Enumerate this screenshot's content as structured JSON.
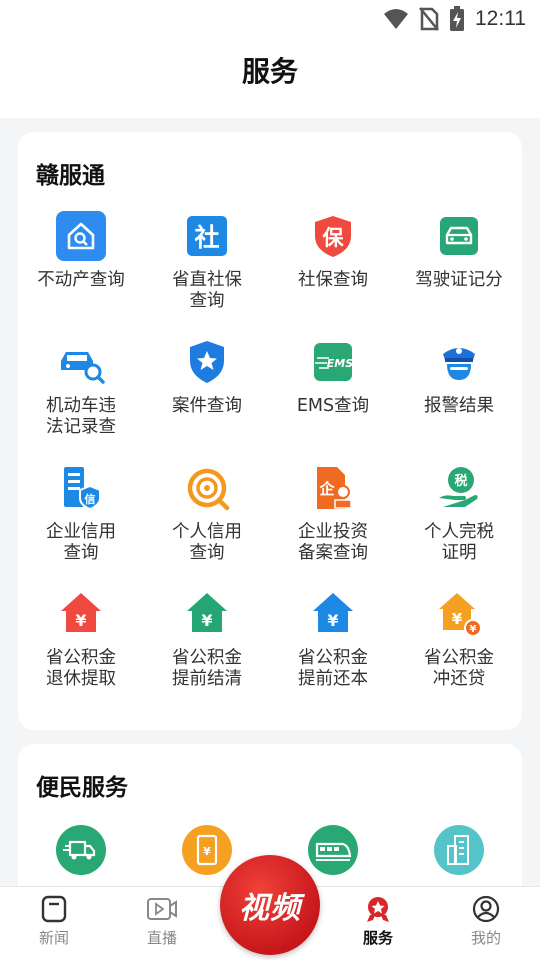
{
  "status": {
    "time": "12:11"
  },
  "header": {
    "title": "服务"
  },
  "section1": {
    "title": "赣服通",
    "items": [
      {
        "label": "不动产查询",
        "icon": "house-search-icon"
      },
      {
        "label": "省直社保\n查询",
        "icon": "social-security-icon"
      },
      {
        "label": "社保查询",
        "icon": "shield-bao-icon"
      },
      {
        "label": "驾驶证记分",
        "icon": "car-icon"
      },
      {
        "label": "机动车违\n法记录查",
        "icon": "car-search-icon"
      },
      {
        "label": "案件查询",
        "icon": "police-badge-icon"
      },
      {
        "label": "EMS查询",
        "icon": "ems-icon"
      },
      {
        "label": "报警结果",
        "icon": "police-officer-icon"
      },
      {
        "label": "企业信用\n查询",
        "icon": "enterprise-credit-icon"
      },
      {
        "label": "个人信用\n查询",
        "icon": "personal-credit-icon"
      },
      {
        "label": "企业投资\n备案查询",
        "icon": "enterprise-investment-icon"
      },
      {
        "label": "个人完税\n证明",
        "icon": "tax-certificate-icon"
      },
      {
        "label": "省公积金\n退休提取",
        "icon": "fund-house-red-icon"
      },
      {
        "label": "省公积金\n提前结清",
        "icon": "fund-house-green-icon"
      },
      {
        "label": "省公积金\n提前还本",
        "icon": "fund-house-blue-icon"
      },
      {
        "label": "省公积金\n冲还贷",
        "icon": "fund-house-orange-icon"
      }
    ]
  },
  "section2": {
    "title": "便民服务",
    "items": [
      {
        "icon": "delivery-truck-icon"
      },
      {
        "icon": "mobile-payment-icon"
      },
      {
        "icon": "train-icon"
      },
      {
        "icon": "building-icon"
      }
    ]
  },
  "tabbar": {
    "tabs": [
      {
        "label": "新闻",
        "icon": "news-icon"
      },
      {
        "label": "直播",
        "icon": "live-icon"
      },
      {
        "label": "服务",
        "icon": "service-icon",
        "active": true
      },
      {
        "label": "我的",
        "icon": "profile-icon"
      }
    ],
    "video_label": "视频"
  },
  "colors": {
    "accent_red": "#d8262a",
    "blue": "#1e88e5",
    "green": "#25a96f",
    "orange": "#f5a020",
    "teal": "#4fc3c8"
  }
}
